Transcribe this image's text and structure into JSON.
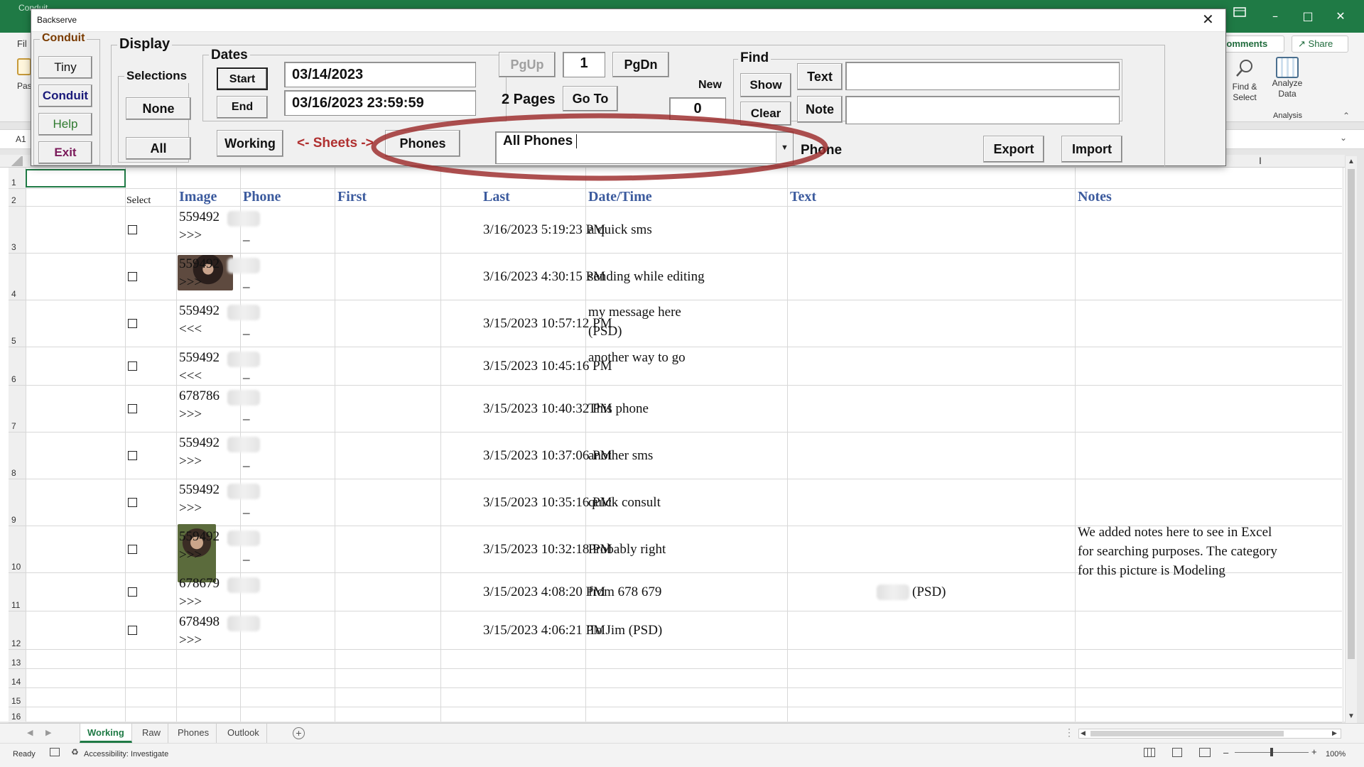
{
  "excel": {
    "window_title": "Conduit",
    "file_tab": "Fil",
    "comments_label": "Comments",
    "share_label": "Share",
    "paste_label": "Pas",
    "find_select_label": [
      "Find &",
      "Select"
    ],
    "analyze_data_label": [
      "Analyze",
      "Data"
    ],
    "analysis_group": "Analysis",
    "name_box": "A1",
    "columns": [
      "Select",
      "Image",
      "Phone",
      "First",
      "Last",
      "Date/Time",
      "Text",
      "Notes"
    ],
    "row_numbers": [
      "1",
      "2",
      "3",
      "4",
      "5",
      "6",
      "7",
      "8",
      "9",
      "10",
      "11",
      "12",
      "13",
      "14",
      "15",
      "16"
    ],
    "rows": [
      {
        "phone": "559492",
        "dir": ">>>",
        "first": "_",
        "datetime": "3/16/2023 5:19:23 PM",
        "text": [
          "a quick sms"
        ],
        "notes": [],
        "image": false
      },
      {
        "phone": "559492",
        "dir": ">>>",
        "first": "_",
        "datetime": "3/16/2023 4:30:15 PM",
        "text": [
          "sending while editing"
        ],
        "notes": [],
        "image": true
      },
      {
        "phone": "559492",
        "dir": "<<<",
        "first": "_",
        "datetime": "3/15/2023 10:57:12 PM",
        "text": [
          "my message here",
          "(PSD)"
        ],
        "notes": [],
        "image": false
      },
      {
        "phone": "559492",
        "dir": "<<<",
        "first": "_",
        "datetime": "3/15/2023 10:45:16 PM",
        "text": [
          "another way to go"
        ],
        "notes": [],
        "image": false
      },
      {
        "phone": "678786",
        "dir": ">>>",
        "first": "_",
        "datetime": "3/15/2023 10:40:32 PM",
        "text": [
          "This phone"
        ],
        "notes": [],
        "image": false
      },
      {
        "phone": "559492",
        "dir": ">>>",
        "first": "_",
        "datetime": "3/15/2023 10:37:06 PM",
        "text": [
          "another sms"
        ],
        "notes": [],
        "image": false
      },
      {
        "phone": "559492",
        "dir": ">>>",
        "first": "_",
        "datetime": "3/15/2023 10:35:16 PM",
        "text": [
          "quick consult"
        ],
        "notes": [],
        "image": false
      },
      {
        "phone": "559492",
        "dir": ">>>",
        "first": "_",
        "datetime": "3/15/2023 10:32:18 PM",
        "text": [
          "Probably right"
        ],
        "notes": [
          "We added notes here to see in Excel",
          "for searching purposes. The category",
          "for this picture is Modeling"
        ],
        "image": true
      },
      {
        "phone": "678679",
        "dir": ">>>",
        "first": "",
        "datetime": "3/15/2023 4:08:20 PM",
        "text": [
          "from 678 679",
          "(PSD)"
        ],
        "notes": [],
        "image": false
      },
      {
        "phone": "678498",
        "dir": ">>>",
        "first": "",
        "datetime": "3/15/2023 4:06:21 PM",
        "text": [
          "To Jim (PSD)"
        ],
        "notes": [],
        "image": false
      }
    ],
    "sheet_tabs": [
      "Working",
      "Raw",
      "Phones",
      "Outlook"
    ],
    "active_tab": "Working",
    "status_ready": "Ready",
    "accessibility": "Accessibility: Investigate",
    "zoom": "100%"
  },
  "form": {
    "title": "Backserve",
    "conduit_frame": "Conduit",
    "tiny": "Tiny",
    "conduit": "Conduit",
    "help": "Help",
    "exit": "Exit",
    "display_frame": "Display",
    "selections_frame": "Selections",
    "none": "None",
    "all": "All",
    "dates_frame": "Dates",
    "start": "Start",
    "end": "End",
    "start_date": "03/14/2023",
    "end_date": "03/16/2023 23:59:59",
    "pgup": "PgUp",
    "page_number": "1",
    "pgdn": "PgDn",
    "pages_label": "2 Pages",
    "goto": "Go To",
    "new_label": "New",
    "new_count": "0",
    "working": "Working",
    "sheets_arrow": "<- Sheets ->",
    "phones": "Phones",
    "phone_select": "All Phones",
    "phone_label": "Phone",
    "find_frame": "Find",
    "show": "Show",
    "clear": "Clear",
    "text_label": "Text",
    "note_label": "Note",
    "text_value": "",
    "note_value": "",
    "export": "Export",
    "import": "Import"
  },
  "colors": {
    "excel_green": "#1f7a45",
    "header_blue": "#3c5b9e",
    "conduit_brown": "#7a3b00",
    "sheets_red": "#b03030",
    "annotation_ring": "#9b2a2a"
  }
}
